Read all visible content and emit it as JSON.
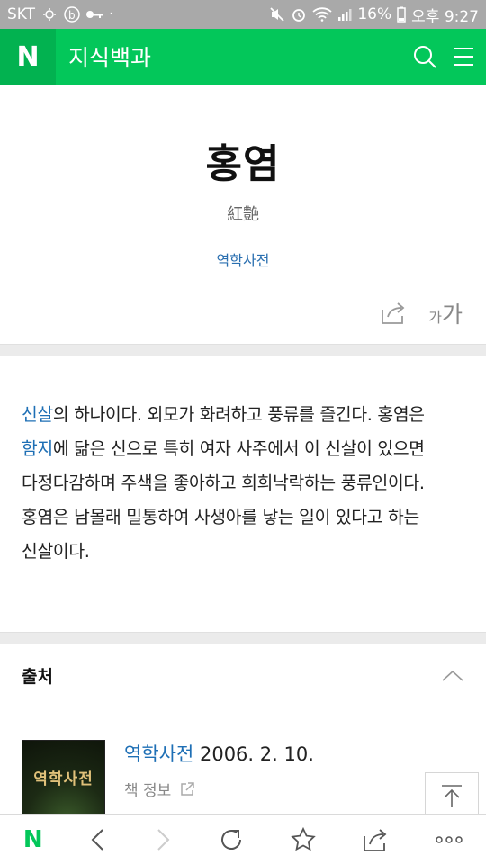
{
  "status_bar": {
    "carrier": "SKT",
    "battery": "16%",
    "time": "오후 9:27"
  },
  "header": {
    "logo": "N",
    "title": "지식백과",
    "icons": [
      "search-icon",
      "menu-icon"
    ]
  },
  "entry": {
    "title": "홍염",
    "hanja": "紅艶",
    "source_link": "역학사전",
    "font_size_label_small": "가",
    "font_size_label_large": "가"
  },
  "body": {
    "link1": "신살",
    "part1": "의 하나이다. 외모가 화려하고 풍류를 즐긴다. 홍염은",
    "link2": "함지",
    "part2": "에 닮은 신으로 특히 여자 사주에서 이 신살이 있으면",
    "line3": "다정다감하며 주색을 좋아하고 희희낙락하는 풍류인이다.",
    "line4": "홍염은 남몰래 밀통하여 사생아를 낳는 일이 있다고 하는",
    "line5": "신살이다."
  },
  "source_section": {
    "heading": "출처",
    "book_cover_text": "역학사전",
    "book_title": "역학사전",
    "book_date": "2006. 2. 10.",
    "book_info": "책 정보"
  },
  "bottom_bar": {
    "home_logo": "N",
    "icons": [
      "back-icon",
      "forward-icon",
      "refresh-icon",
      "star-icon",
      "share-icon",
      "more-icon"
    ]
  },
  "colors": {
    "brand_green": "#03c75a",
    "link_blue": "#1e6fb5"
  }
}
